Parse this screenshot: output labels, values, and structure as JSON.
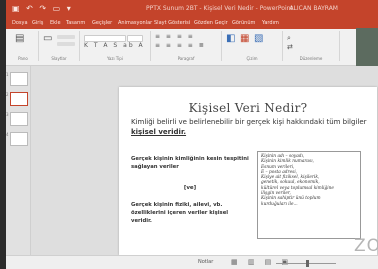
{
  "window": {
    "title": "PPTX Sunum 2BT - Kişisel Veri Nedir - PowerPoint",
    "user": "ALICAN BAYRAM",
    "quick_access": "▣ ↶ ↷ ▭ ▾"
  },
  "menu": [
    "Dosya",
    "Giriş",
    "Ekle",
    "Tasarım",
    "Geçişler",
    "Animasyonlar",
    "Slayt Gösterisi",
    "Gözden Geçir",
    "Görünüm",
    "Yardım"
  ],
  "ribbon": {
    "groups": [
      "Pano",
      "Slaytlar",
      "Yazı Tipi",
      "Paragraf",
      "Çizim",
      "Düzenleme"
    ]
  },
  "thumbnails": [
    "1",
    "2",
    "3",
    "4"
  ],
  "slide": {
    "title": "Kişisel Veri Nedir?",
    "intro": "Kimliği belirli ve belirlenebilir bir gerçek kişi hakkındaki tüm bilgiler",
    "intro_highlight": "kişisel veridir.",
    "left_block_1": "Gerçek kişinin kimliğinin kesin tespitini sağlayan veriler",
    "separator": "[ve]",
    "left_block_2": "Gerçek kişinin fiziki, ailevi, vb. özelliklerini içeren veriler kişisel veridir.",
    "examples": [
      "Kişinin adı – soyadı,",
      "Kişinin kimlik numarası,",
      "Esnum verileri,",
      "E – posta adresi,",
      "Kişiye ait fiziksel, kişilerik,",
      "genetik, sokuul, ekonomik,",
      "kültürel veya toplumsal kimliğine",
      "ilişgin veriler,",
      "Kişinin sahiptir ünü toplum",
      "kurduğuları ile..."
    ]
  },
  "status": {
    "notes": "Notlar",
    "views": "▦ ▥ ▤ ▣"
  },
  "watermark": "ZO"
}
